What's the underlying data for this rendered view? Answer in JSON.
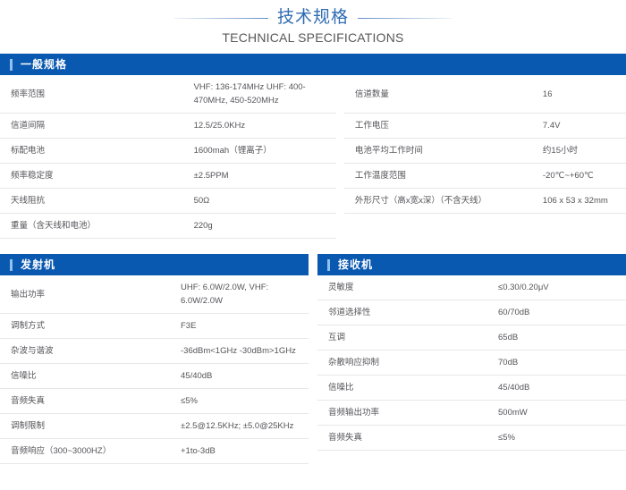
{
  "header": {
    "title_cn": "技术规格",
    "title_en": "TECHNICAL SPECIFICATIONS",
    "accent_color": "#2f6cb2"
  },
  "theme": {
    "section_bar_color": "#0a59b0",
    "section_accent_color": "#8fc0ef",
    "rule_color": "#e7e7e9",
    "text_color": "#55555a"
  },
  "sections": {
    "general": {
      "title": "一般规格",
      "left_rows": [
        {
          "label": "频率范围",
          "value": "VHF: 136-174MHz UHF: 400-470MHz, 450-520MHz"
        },
        {
          "label": "信道间隔",
          "value": "12.5/25.0KHz"
        },
        {
          "label": "标配电池",
          "value": "1600mah（锂离子）"
        },
        {
          "label": "频率稳定度",
          "value": "±2.5PPM"
        },
        {
          "label": "天线阻抗",
          "value": "50Ω"
        },
        {
          "label": "重量（含天线和电池）",
          "value": "220g"
        }
      ],
      "right_rows": [
        {
          "label": "信道数量",
          "value": "16"
        },
        {
          "label": "工作电压",
          "value": "7.4V"
        },
        {
          "label": "电池平均工作时间",
          "value": "约15小时"
        },
        {
          "label": "工作温度范围",
          "value": "-20℃~+60℃"
        },
        {
          "label": "外形尺寸（高x宽x深）（不含天线）",
          "value": "106 x 53 x 32mm"
        },
        {
          "label": "",
          "value": ""
        }
      ]
    },
    "transmitter": {
      "title": "发射机",
      "rows": [
        {
          "label": "输出功率",
          "value": "UHF: 6.0W/2.0W, VHF: 6.0W/2.0W"
        },
        {
          "label": "调制方式",
          "value": "F3E"
        },
        {
          "label": "杂波与谐波",
          "value": "-36dBm<1GHz -30dBm>1GHz"
        },
        {
          "label": "信噪比",
          "value": "45/40dB"
        },
        {
          "label": "音频失真",
          "value": "≤5%"
        },
        {
          "label": "调制限制",
          "value": "±2.5@12.5KHz; ±5.0@25KHz"
        },
        {
          "label": "音频响应（300~3000HZ）",
          "value": "+1to-3dB"
        }
      ]
    },
    "receiver": {
      "title": "接收机",
      "rows": [
        {
          "label": "灵敏度",
          "value": "≤0.30/0.20μV"
        },
        {
          "label": "邻道选择性",
          "value": "60/70dB"
        },
        {
          "label": "互调",
          "value": "65dB"
        },
        {
          "label": "杂散响应抑制",
          "value": "70dB"
        },
        {
          "label": "信噪比",
          "value": "45/40dB"
        },
        {
          "label": "音频输出功率",
          "value": "500mW"
        },
        {
          "label": "音频失真",
          "value": "≤5%"
        }
      ]
    }
  }
}
